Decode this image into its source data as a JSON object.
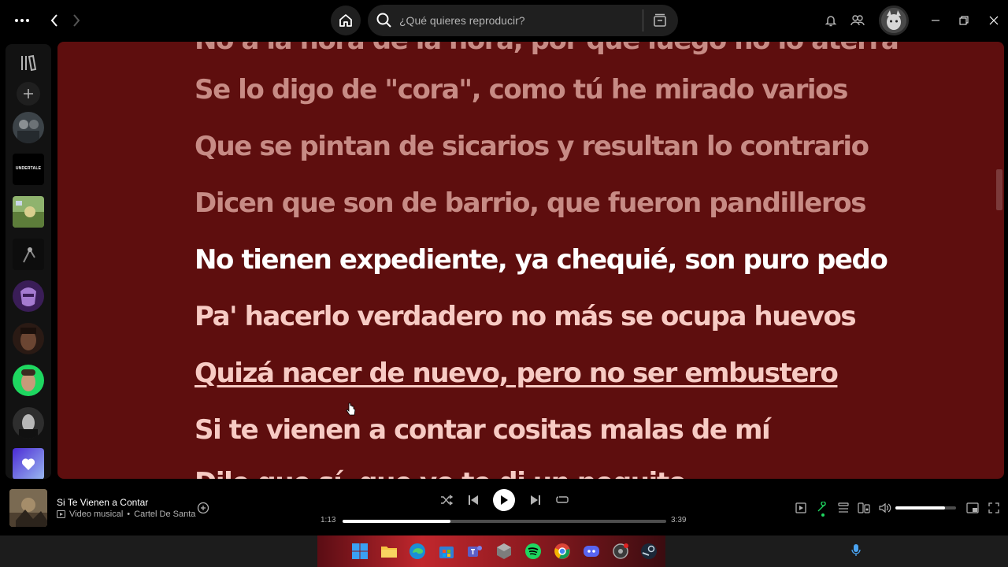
{
  "topbar": {
    "search_placeholder": "¿Qué quieres reproducir?",
    "icons": [
      "more-icon",
      "back-icon",
      "forward-icon",
      "home-icon",
      "search-icon",
      "browse-icon",
      "bell-icon",
      "friends-icon",
      "minimize-icon",
      "restore-icon",
      "close-icon"
    ]
  },
  "sidebar": {
    "icons": [
      "library-icon",
      "plus-icon"
    ],
    "playlists": [
      "playlist-1",
      "playlist-undertale",
      "playlist-3",
      "playlist-4",
      "playlist-5",
      "playlist-6",
      "playlist-7",
      "playlist-8",
      "playlist-liked"
    ],
    "undertale_label": "UNDERTALE"
  },
  "lyrics": {
    "past": [
      "Se lo digo de \"cora\", como tú he mirado varios",
      "Que se pintan de sicarios y resultan lo contrario",
      "Dicen que son de barrio, que fueron pandilleros"
    ],
    "current": "No tienen expediente, ya chequié, son puro pedo",
    "future": [
      "Pa' hacerlo verdadero no más se ocupa huevos",
      "Quizá nacer de nuevo, pero no ser embustero",
      "Si te vienen a contar cositas malas de mí"
    ]
  },
  "player": {
    "title": "Si Te Vienen a Contar",
    "type": "Video musical",
    "artist": "Cartel De Santa",
    "elapsed": "1:13",
    "duration": "3:39",
    "progress": 0.333,
    "volume": 0.82
  },
  "colors": {
    "lyrics_bg": "#5e0e0e",
    "past_line": "#c78b85",
    "current_line": "#ffffff",
    "future_line": "#f7cbc4",
    "accent_green": "#1ed760"
  }
}
